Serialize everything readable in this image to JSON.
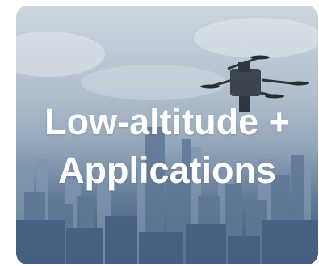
{
  "card": {
    "title_line1": "Low-altitude +",
    "title_line2": "Applications"
  },
  "colors": {
    "sky_top": "#c8d3dd",
    "city": "#4a6281",
    "text": "#ffffff"
  }
}
